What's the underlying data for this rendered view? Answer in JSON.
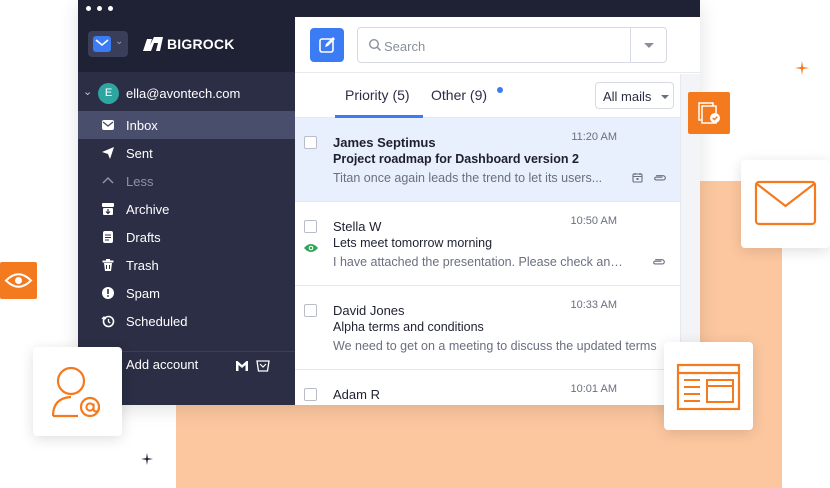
{
  "brand": {
    "name": "BIGROCK"
  },
  "account": {
    "initial": "E",
    "email": "ella@avontech.com"
  },
  "folders": [
    {
      "label": "Inbox",
      "icon": "inbox-icon"
    },
    {
      "label": "Sent",
      "icon": "send-icon"
    },
    {
      "label": "Less",
      "icon": "chevron-up-icon"
    },
    {
      "label": "Archive",
      "icon": "archive-icon"
    },
    {
      "label": "Drafts",
      "icon": "drafts-icon"
    },
    {
      "label": "Trash",
      "icon": "trash-icon"
    },
    {
      "label": "Spam",
      "icon": "spam-icon"
    },
    {
      "label": "Scheduled",
      "icon": "scheduled-icon"
    }
  ],
  "add_account": {
    "label": "Add account"
  },
  "search": {
    "placeholder": "Search"
  },
  "tabs": [
    {
      "label": "Priority (5)"
    },
    {
      "label": "Other (9)"
    }
  ],
  "filter": {
    "label": "All mails"
  },
  "messages": [
    {
      "sender": "James Septimus",
      "subject": "Project roadmap for Dashboard version 2",
      "preview": "Titan once again leads the trend to let its users...",
      "time": "11:20 AM"
    },
    {
      "sender": "Stella W",
      "subject": "Lets meet tomorrow morning",
      "preview": "I have attached the presentation. Please check and let me know",
      "time": "10:50 AM"
    },
    {
      "sender": "David Jones",
      "subject": "Alpha terms and conditions",
      "preview": "We need to get on a meeting to discuss the updated terms",
      "time": "10:33 AM"
    },
    {
      "sender": "Adam R",
      "subject": "",
      "preview": "",
      "time": "10:01 AM"
    }
  ],
  "colors": {
    "accent": "#3b7cf5",
    "sidebar": "#2b2e44",
    "orange": "#f47a20",
    "peach": "#fcc79f"
  }
}
